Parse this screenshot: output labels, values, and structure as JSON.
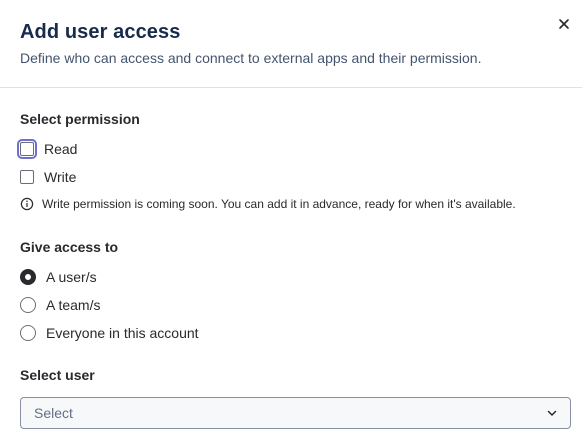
{
  "dialog": {
    "title": "Add user access",
    "subtitle": "Define who can access and connect to external apps and their permission.",
    "close_icon": "close-icon"
  },
  "permission": {
    "label": "Select permission",
    "options": [
      {
        "label": "Read",
        "checked": false,
        "focused": true
      },
      {
        "label": "Write",
        "checked": false,
        "focused": false
      }
    ],
    "info_icon": "info-icon",
    "info_text": "Write permission is coming soon. You can add it in advance, ready for when it's available."
  },
  "access": {
    "label": "Give access to",
    "options": [
      {
        "label": "A user/s",
        "selected": true
      },
      {
        "label": "A team/s",
        "selected": false
      },
      {
        "label": "Everyone in this account",
        "selected": false
      }
    ]
  },
  "select_user": {
    "label": "Select user",
    "placeholder": "Select",
    "chevron_icon": "chevron-down-icon"
  },
  "colors": {
    "focus_ring": "#6f6fd0",
    "divider": "#dfe1e6",
    "text": "#292a2e"
  }
}
